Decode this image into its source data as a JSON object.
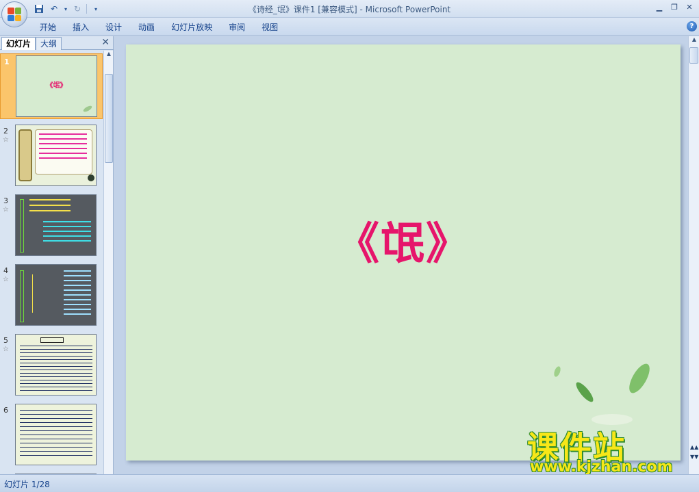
{
  "window": {
    "title": "《诗经_氓》课件1 [兼容模式] - Microsoft PowerPoint"
  },
  "ribbon": {
    "tabs": [
      {
        "label": "开始"
      },
      {
        "label": "插入"
      },
      {
        "label": "设计"
      },
      {
        "label": "动画"
      },
      {
        "label": "幻灯片放映"
      },
      {
        "label": "审阅"
      },
      {
        "label": "视图"
      }
    ]
  },
  "left_panel": {
    "tabs": [
      {
        "label": "幻灯片"
      },
      {
        "label": "大纲"
      }
    ],
    "thumbnails": [
      {
        "number": "1",
        "has_animation": false,
        "selected": true
      },
      {
        "number": "2",
        "has_animation": true,
        "selected": false
      },
      {
        "number": "3",
        "has_animation": true,
        "selected": false
      },
      {
        "number": "4",
        "has_animation": true,
        "selected": false
      },
      {
        "number": "5",
        "has_animation": true,
        "selected": false
      },
      {
        "number": "6",
        "has_animation": false,
        "selected": false
      }
    ],
    "thumb1_title": "《氓》"
  },
  "slide": {
    "title": "《氓》",
    "title_color": "#e6156b",
    "background": "#d6ebd0"
  },
  "watermark": {
    "cn": "课件站",
    "url": "www.kjzhan.com"
  },
  "status": {
    "slide_indicator": "幻灯片 1/28"
  },
  "colors": {
    "accent": "#15428b",
    "selection": "#fbc56b"
  }
}
